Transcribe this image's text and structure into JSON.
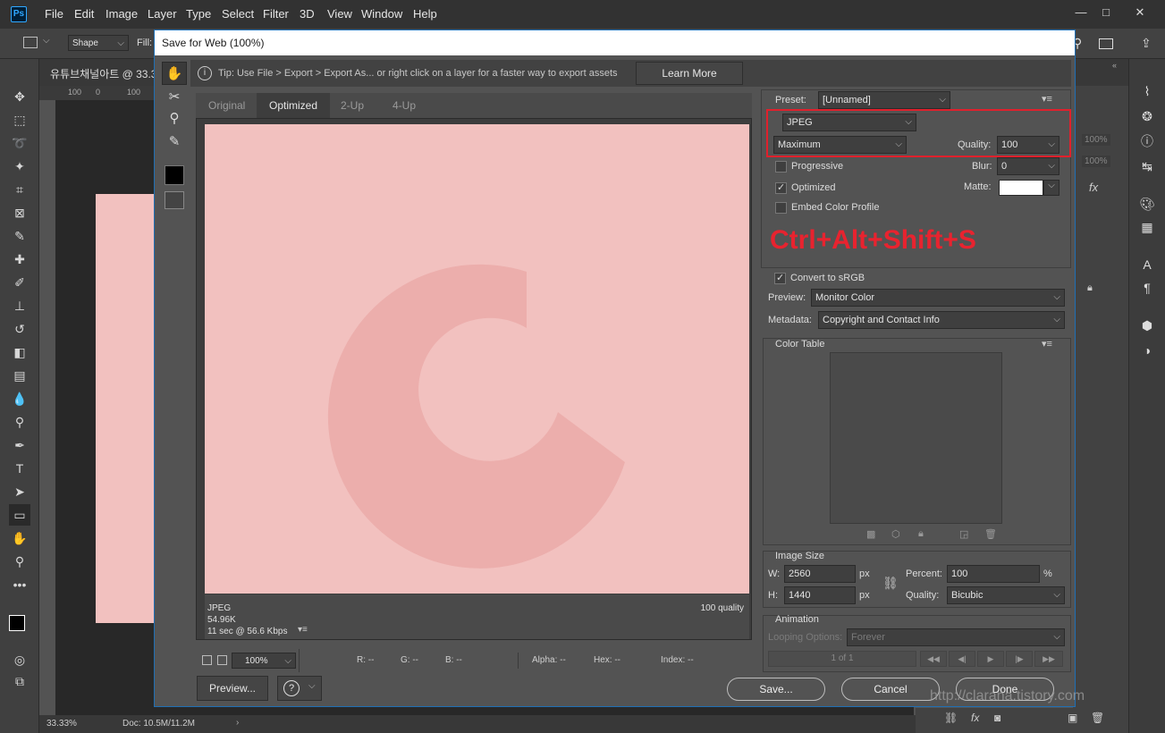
{
  "app": {
    "logo": "Ps",
    "menu": [
      "File",
      "Edit",
      "Image",
      "Layer",
      "Type",
      "Select",
      "Filter",
      "3D",
      "View",
      "Window",
      "Help"
    ],
    "window_buttons": [
      "—",
      "□",
      "✕"
    ]
  },
  "options_bar": {
    "shape_mode": "Shape",
    "fill_label": "Fill:"
  },
  "doc_tab": {
    "title": "유튜브채널아트 @ 33.3",
    "ruler": [
      "100",
      "0",
      "100"
    ]
  },
  "status_bar": {
    "zoom": "33.33%",
    "doc": "Doc: 10.5M/11.2M"
  },
  "dialog": {
    "title": "Save for Web (100%)",
    "tip": "Tip: Use File > Export > Export As...  or right click on a layer for a faster way to export assets",
    "learn_more": "Learn More",
    "tabs": [
      "Original",
      "Optimized",
      "2-Up",
      "4-Up"
    ],
    "active_tab": "Optimized",
    "preview": {
      "format": "JPEG",
      "size": "54.96K",
      "time": "11 sec @ 56.6 Kbps",
      "quality_note": "100 quality"
    },
    "bottom": {
      "zoom": "100%",
      "r": "R: --",
      "g": "G: --",
      "b": "B: --",
      "alpha": "Alpha: --",
      "hex": "Hex: --",
      "index": "Index: --"
    },
    "preview_button": "Preview...",
    "save_button": "Save...",
    "cancel_button": "Cancel",
    "done_button": "Done",
    "settings": {
      "preset_label": "Preset:",
      "preset_value": "[Unnamed]",
      "format": "JPEG",
      "quality_preset": "Maximum",
      "quality_label": "Quality:",
      "quality_value": "100",
      "progressive_label": "Progressive",
      "progressive_checked": false,
      "blur_label": "Blur:",
      "blur_value": "0",
      "optimized_label": "Optimized",
      "optimized_checked": true,
      "matte_label": "Matte:",
      "embed_label": "Embed Color Profile",
      "embed_checked": false,
      "shortcut_annotation": "Ctrl+Alt+Shift+S",
      "convert_label": "Convert to sRGB",
      "convert_checked": true,
      "preview_label": "Preview:",
      "preview_value": "Monitor Color",
      "metadata_label": "Metadata:",
      "metadata_value": "Copyright and Contact Info"
    },
    "color_table": {
      "title": "Color Table"
    },
    "image_size": {
      "title": "Image Size",
      "w_label": "W:",
      "w_value": "2560",
      "h_label": "H:",
      "h_value": "1440",
      "unit": "px",
      "percent_label": "Percent:",
      "percent_value": "100",
      "percent_unit": "%",
      "quality_label": "Quality:",
      "quality_value": "Bicubic"
    },
    "animation": {
      "title": "Animation",
      "looping_label": "Looping Options:",
      "looping_value": "Forever",
      "frame_counter": "1 of 1"
    }
  },
  "watermark": "http://clarana.tistory.com",
  "colors": {
    "accent_red": "#e0202c",
    "pink_canvas": "#f2c1bf",
    "logo_pink": "#ecaeac",
    "dialog_border": "#1f6fb5"
  },
  "right_panel": {
    "percent_1": "100%",
    "percent_2": "100%",
    "fx": "fx"
  }
}
